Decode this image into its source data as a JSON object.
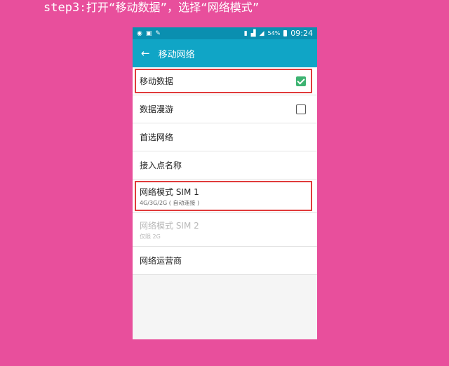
{
  "caption": {
    "step": "step3",
    "text": ":打开“移动数据”，选择“网络模式”"
  },
  "statusbar": {
    "battery": "54%",
    "time": "09:24"
  },
  "appbar": {
    "title": "移动网络"
  },
  "rows": [
    {
      "label": "移动数据",
      "checked": true
    },
    {
      "label": "数据漫游",
      "checked": false
    },
    {
      "label": "首选网络"
    },
    {
      "label": "接入点名称"
    },
    {
      "label": "网络模式 SIM 1",
      "sub": "4G/3G/2G ( 自动连接 )"
    },
    {
      "label": "网络模式 SIM 2",
      "sub": "仅限 2G"
    },
    {
      "label": "网络运营商"
    }
  ]
}
